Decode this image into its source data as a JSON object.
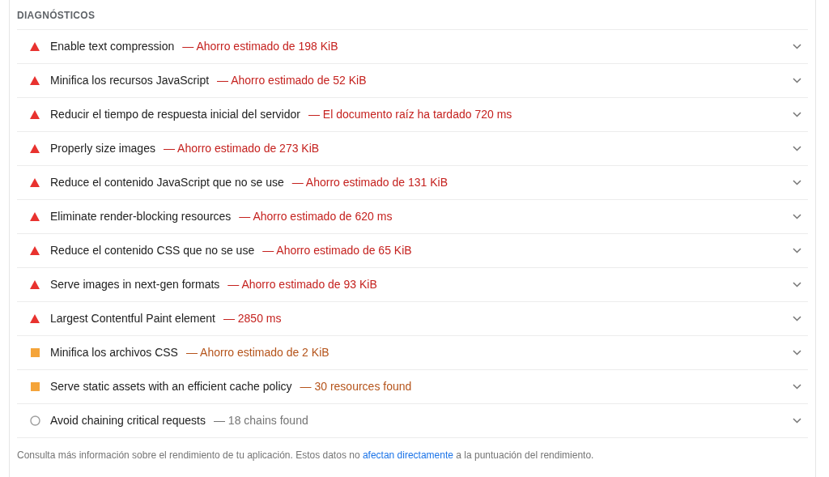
{
  "section": {
    "title": "DIAGNÓSTICOS"
  },
  "audits": [
    {
      "kind": "fail",
      "title": "Enable text compression",
      "detail": "— Ahorro estimado de 198 KiB",
      "expanded": false
    },
    {
      "kind": "fail",
      "title": "Minifica los recursos JavaScript",
      "detail": "— Ahorro estimado de 52 KiB",
      "expanded": false
    },
    {
      "kind": "fail",
      "title": "Reducir el tiempo de respuesta inicial del servidor",
      "detail": "— El documento raíz ha tardado 720 ms",
      "expanded": false
    },
    {
      "kind": "fail",
      "title": "Properly size images",
      "detail": "— Ahorro estimado de 273 KiB",
      "expanded": false
    },
    {
      "kind": "fail",
      "title": "Reduce el contenido JavaScript que no se use",
      "detail": "— Ahorro estimado de 131 KiB",
      "expanded": false
    },
    {
      "kind": "fail",
      "title": "Eliminate render-blocking resources",
      "detail": "— Ahorro estimado de 620 ms",
      "expanded": false
    },
    {
      "kind": "fail",
      "title": "Reduce el contenido CSS que no se use",
      "detail": "— Ahorro estimado de 65 KiB",
      "expanded": false
    },
    {
      "kind": "fail",
      "title": "Serve images in next-gen formats",
      "detail": "— Ahorro estimado de 93 KiB",
      "expanded": false
    },
    {
      "kind": "fail",
      "title": "Largest Contentful Paint element",
      "detail": "— 2850 ms",
      "expanded": false
    },
    {
      "kind": "average",
      "title": "Minifica los archivos CSS",
      "detail": "— Ahorro estimado de 2 KiB",
      "expanded": false
    },
    {
      "kind": "average",
      "title": "Serve static assets with an efficient cache policy",
      "detail": "— 30 resources found",
      "expanded": false
    },
    {
      "kind": "info",
      "title": "Avoid chaining critical requests",
      "detail": "— 18 chains found",
      "expanded": false
    }
  ],
  "footer": {
    "before": "Consulta más información sobre el rendimiento de tu aplicación. Estos datos no ",
    "link": "afectan directamente",
    "after": " a la puntuación del rendimiento."
  }
}
